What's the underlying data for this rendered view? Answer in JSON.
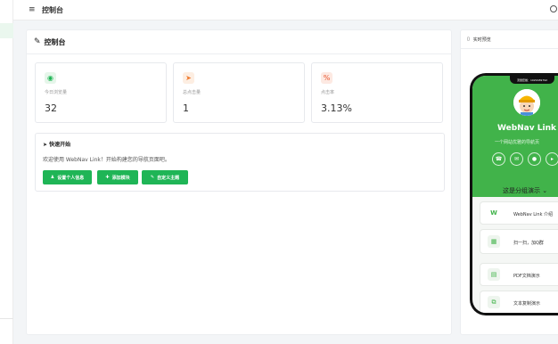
{
  "topbar": {
    "menu_icon": "≡",
    "title": "控制台",
    "user_icon": "circle-icon"
  },
  "main": {
    "title": "控制台",
    "stats": [
      {
        "label": "今日浏览量",
        "value": "32",
        "icon": "eye-icon",
        "color": "#1fb556",
        "bg": "#e6f6ea",
        "glyph": "◉"
      },
      {
        "label": "总点击量",
        "value": "1",
        "icon": "cursor-icon",
        "color": "#f07a2e",
        "bg": "#fdeee2",
        "glyph": "➤"
      },
      {
        "label": "点击率",
        "value": "3.13%",
        "icon": "percent-icon",
        "color": "#e8562f",
        "bg": "#fde9e2",
        "glyph": "%"
      }
    ],
    "quick": {
      "title": "快速开始",
      "desc": "欢迎使用 WebNav Link！开始构建您的导航页面吧。",
      "buttons": [
        {
          "label": "设置个人信息",
          "glyph": "♟"
        },
        {
          "label": "添加模块",
          "glyph": "✚"
        },
        {
          "label": "自定义主题",
          "glyph": "✎"
        }
      ]
    }
  },
  "preview": {
    "title": "实时预览",
    "notch_text": "流量套餐：1029189792",
    "profile_title": "WebNav Link",
    "profile_subtitle": "一个网站优雅的导航页",
    "social": [
      "☎",
      "✉",
      "●",
      "▸"
    ],
    "section_title": "这是分组演示",
    "links": [
      {
        "label": "WebNav Link 介绍",
        "glyph": "W"
      },
      {
        "label": "扫一扫，加Q群",
        "glyph": "▦"
      },
      {
        "label": "PDF文档演示",
        "glyph": "▤"
      },
      {
        "label": "文本复制演示",
        "glyph": "⧉"
      }
    ]
  },
  "colors": {
    "accent": "#1fb556",
    "phone_green": "#41b34a"
  }
}
